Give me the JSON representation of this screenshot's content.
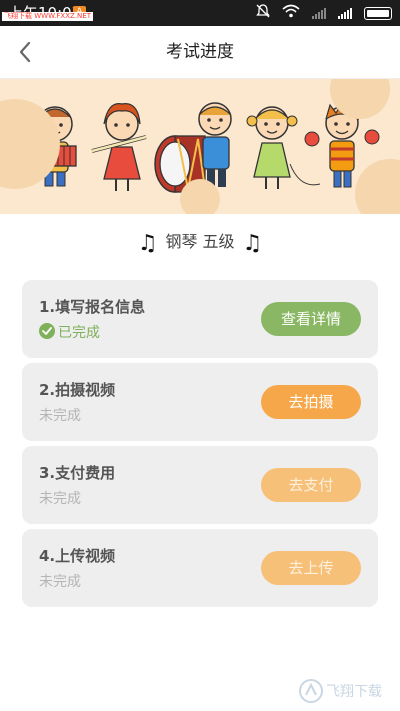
{
  "status": {
    "time": "上午10:07",
    "watermark": "飞翔下载 WWW.FXXZ.NET"
  },
  "header": {
    "title": "考试进度"
  },
  "instrument": {
    "label": "钢琴 五级",
    "note_glyph": "♫"
  },
  "steps": [
    {
      "title": "1.填写报名信息",
      "status": "已完成",
      "button": "查看详情",
      "state": "done"
    },
    {
      "title": "2.拍摄视频",
      "status": "未完成",
      "button": "去拍摄",
      "state": "active"
    },
    {
      "title": "3.支付费用",
      "status": "未完成",
      "button": "去支付",
      "state": "disabled"
    },
    {
      "title": "4.上传视频",
      "status": "未完成",
      "button": "去上传",
      "state": "disabled"
    }
  ],
  "colors": {
    "done_green": "#8ab763",
    "active_orange": "#f6a74a",
    "disabled_orange": "#f7c079",
    "banner_bg": "#fbe8cf",
    "card_bg": "#eeeeee"
  },
  "footer_watermark": "飞翔下载"
}
